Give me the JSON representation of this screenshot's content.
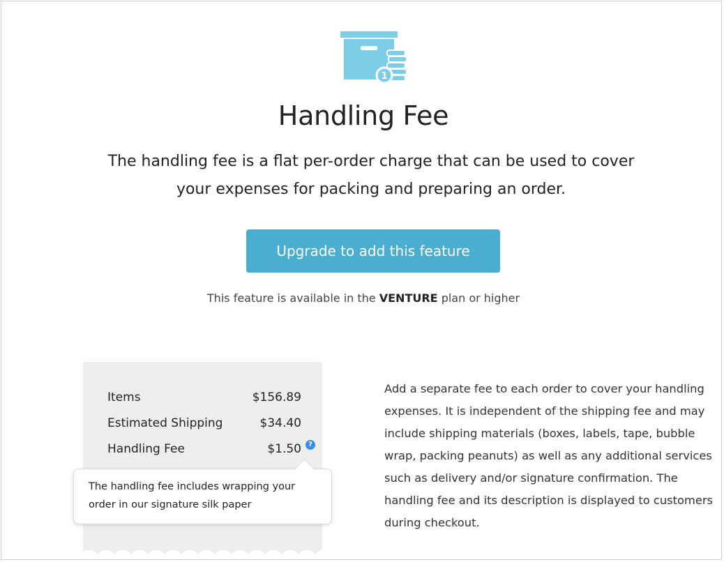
{
  "hero": {
    "icon": "archive-box-coins-icon",
    "badge_number": "1",
    "title": "Handling Fee",
    "subtitle": "The handling fee is a flat per-order charge that can be used to cover your expenses for packing and preparing an order."
  },
  "upgrade": {
    "button_label": "Upgrade to add this feature",
    "plan_note_prefix": "This feature is available in the",
    "plan_name": "VENTURE",
    "plan_note_suffix": "plan or higher"
  },
  "receipt": {
    "rows": [
      {
        "label": "Items",
        "value": "$156.89"
      },
      {
        "label": "Estimated Shipping",
        "value": "$34.40"
      },
      {
        "label": "Handling Fee",
        "value": "$1.50"
      }
    ],
    "help_icon": "question-circle-icon",
    "help_icon_glyph": "?",
    "tooltip_text": "The handling fee includes wrapping your order in our signature silk paper"
  },
  "description": "Add a separate fee to each order to cover your handling expenses. It is independent of the shipping fee and may include shipping materials (boxes, labels, tape, bubble wrap, packing peanuts) as well as any additional services such as delivery and/or signature confirmation. The handling fee and its description is displayed to customers during checkout.",
  "colors": {
    "accent": "#4aaed0",
    "icon_blue": "#7ecde6",
    "receipt_bg": "#eeeeee",
    "help_blue": "#3a8ee6"
  }
}
